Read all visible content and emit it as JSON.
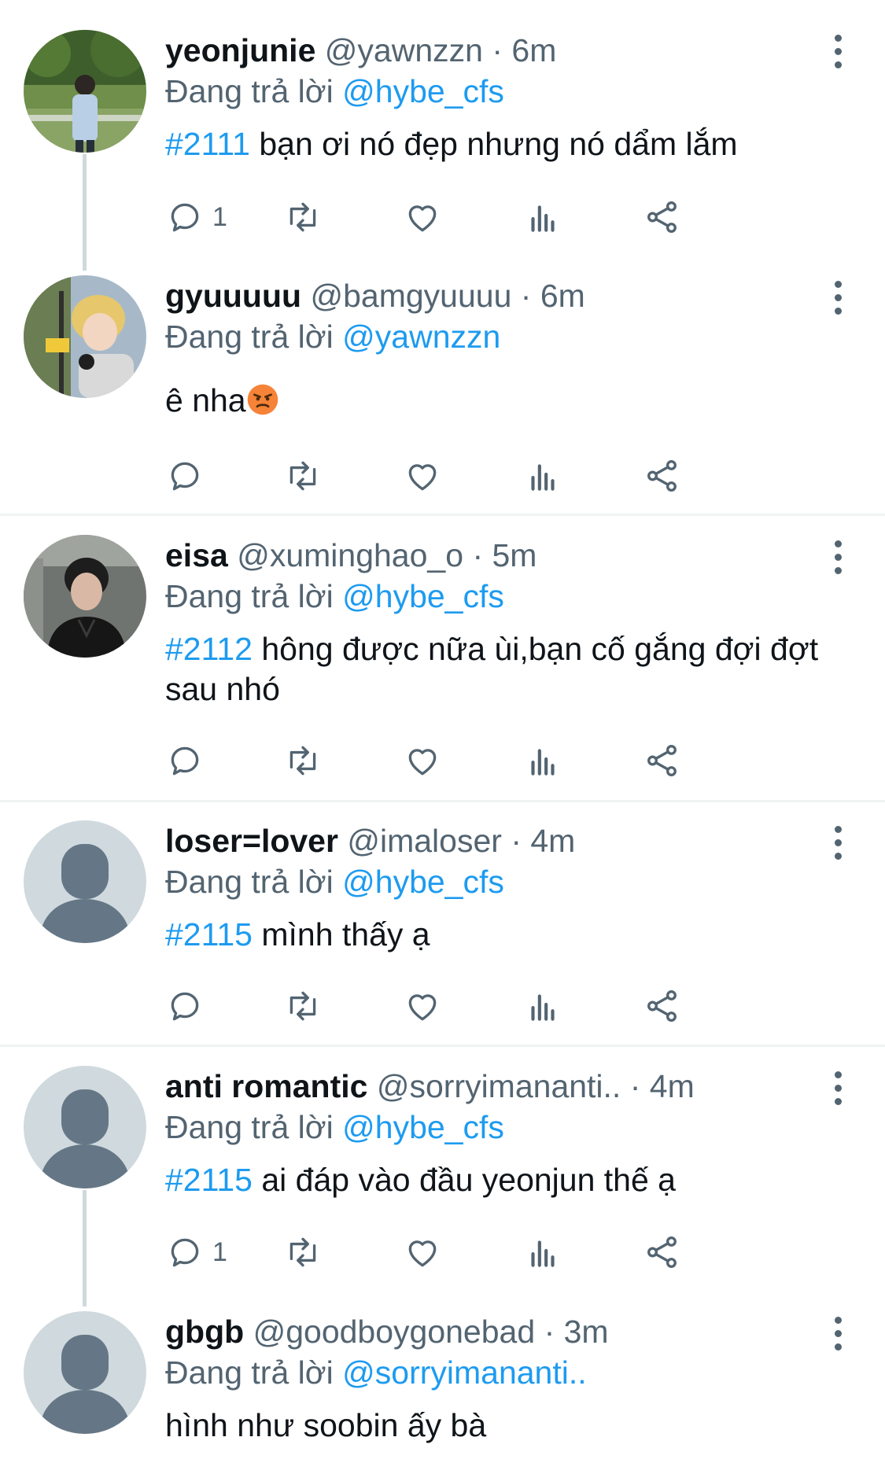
{
  "colors": {
    "accent": "#1d9bf0",
    "secondary": "#536471",
    "text": "#0f1419",
    "divider": "#eff3f4"
  },
  "tweets": [
    {
      "name": "yeonjunie",
      "handle": "@yawnzzn",
      "dot": "·",
      "time": "6m",
      "replying_label": "Đang trả lời",
      "replying_to": "@hybe_cfs",
      "hashtag": "#2111",
      "text": "bạn ơi nó đẹp nhưng nó dẩm lắm",
      "reply_count": "1",
      "avatar": "photo-avatar-park"
    },
    {
      "name": "gyuuuuu",
      "handle": "@bamgyuuuu",
      "dot": "·",
      "time": "6m",
      "replying_label": "Đang trả lời",
      "replying_to": "@yawnzzn",
      "hashtag": "",
      "text": "ê nha",
      "emoji": "angry-face-emoji",
      "reply_count": "",
      "avatar": "photo-avatar-blonde"
    },
    {
      "name": "eisa",
      "handle": "@xuminghao_o",
      "dot": "·",
      "time": "5m",
      "replying_label": "Đang trả lời",
      "replying_to": "@hybe_cfs",
      "hashtag": "#2112",
      "text": "hông được nữa ùi,bạn cố gắng đợi đợt sau nhó",
      "reply_count": "",
      "avatar": "photo-avatar-dark"
    },
    {
      "name": "loser=lover",
      "handle": "@imaloser",
      "dot": "·",
      "time": "4m",
      "replying_label": "Đang trả lời",
      "replying_to": "@hybe_cfs",
      "hashtag": "#2115",
      "text": "mình thấy ạ",
      "reply_count": "",
      "avatar": "default-avatar"
    },
    {
      "name": "anti romantic",
      "handle": "@sorryimananti..",
      "dot": "·",
      "time": "4m",
      "replying_label": "Đang trả lời",
      "replying_to": "@hybe_cfs",
      "hashtag": "#2115",
      "text": "ai đáp vào đầu yeonjun thế ạ",
      "reply_count": "1",
      "avatar": "default-avatar"
    },
    {
      "name": "gbgb",
      "handle": "@goodboygonebad",
      "dot": "·",
      "time": "3m",
      "replying_label": "Đang trả lời",
      "replying_to": "@sorryimananti..",
      "hashtag": "",
      "text": "hình như soobin ấy bà",
      "reply_count": "",
      "avatar": "default-avatar"
    }
  ]
}
